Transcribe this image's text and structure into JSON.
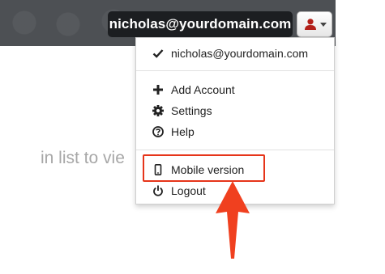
{
  "header": {
    "user_email": "nicholas@yourdomain.com"
  },
  "background": {
    "partial_text": "in list to vie"
  },
  "dropdown": {
    "current_account": "nicholas@yourdomain.com",
    "items": [
      {
        "label": "Add Account",
        "icon": "plus-icon"
      },
      {
        "label": "Settings",
        "icon": "gear-icon"
      },
      {
        "label": "Help",
        "icon": "help-icon"
      },
      {
        "label": "Mobile version",
        "icon": "mobile-icon"
      },
      {
        "label": "Logout",
        "icon": "power-icon"
      }
    ]
  },
  "annotation": {
    "highlight_color": "#e6351a",
    "arrow_color": "#f0401f"
  }
}
